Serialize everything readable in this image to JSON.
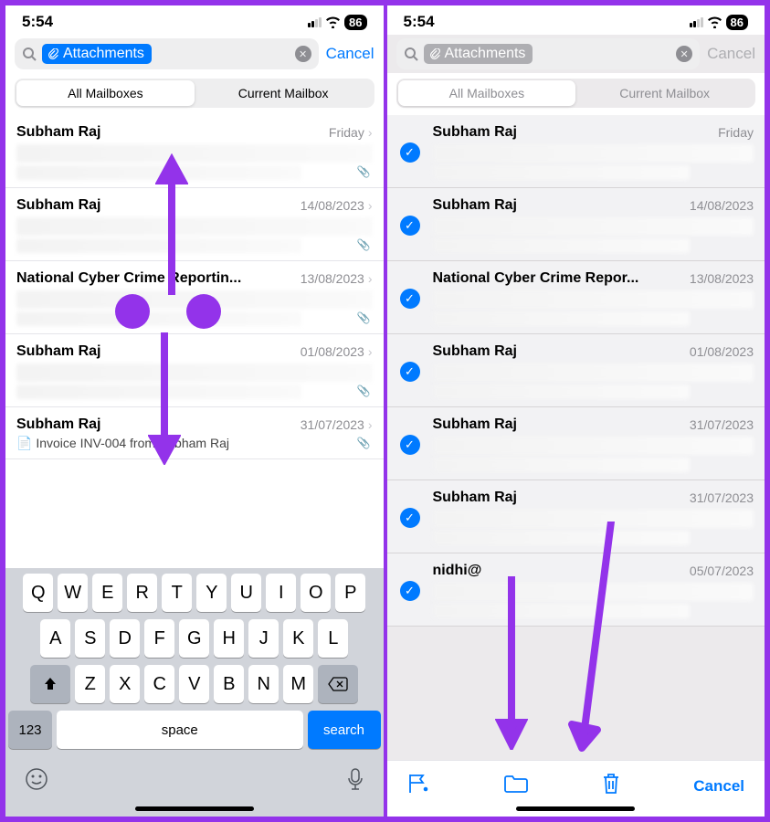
{
  "status": {
    "time": "5:54",
    "battery": "86"
  },
  "search": {
    "token": "Attachments",
    "cancel": "Cancel"
  },
  "seg": {
    "all": "All Mailboxes",
    "current": "Current Mailbox"
  },
  "left": {
    "items": [
      {
        "sender": "Subham Raj",
        "date": "Friday"
      },
      {
        "sender": "Subham Raj",
        "date": "14/08/2023"
      },
      {
        "sender": "National Cyber Crime Reportin...",
        "date": "13/08/2023"
      },
      {
        "sender": "Subham Raj",
        "date": "01/08/2023"
      },
      {
        "sender": "Subham Raj",
        "date": "31/07/2023",
        "sub": "Invoice INV-004 from Subham Raj"
      }
    ]
  },
  "right": {
    "items": [
      {
        "sender": "Subham Raj",
        "date": "Friday"
      },
      {
        "sender": "Subham Raj",
        "date": "14/08/2023"
      },
      {
        "sender": "National Cyber Crime Repor...",
        "date": "13/08/2023"
      },
      {
        "sender": "Subham Raj",
        "date": "01/08/2023"
      },
      {
        "sender": "Subham Raj",
        "date": "31/07/2023"
      },
      {
        "sender": "Subham Raj",
        "date": "31/07/2023"
      },
      {
        "sender": "nidhi@",
        "date": "05/07/2023"
      }
    ]
  },
  "keys": {
    "r1": [
      "Q",
      "W",
      "E",
      "R",
      "T",
      "Y",
      "U",
      "I",
      "O",
      "P"
    ],
    "r2": [
      "A",
      "S",
      "D",
      "F",
      "G",
      "H",
      "J",
      "K",
      "L"
    ],
    "r3": [
      "Z",
      "X",
      "C",
      "V",
      "B",
      "N",
      "M"
    ],
    "num": "123",
    "space": "space",
    "search": "search"
  },
  "toolbar": {
    "cancel": "Cancel"
  },
  "chart_data": null
}
